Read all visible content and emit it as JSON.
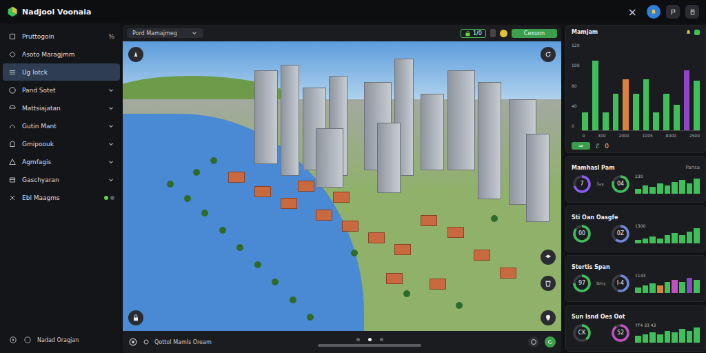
{
  "app": {
    "title": "Nadjool Voonaia"
  },
  "topbar": {
    "close": "×"
  },
  "sidebar": {
    "items": [
      {
        "label": "Pruttogoin",
        "badge": "⅜",
        "expandable": false,
        "selected": false
      },
      {
        "label": "Asoto Maragjmm",
        "expandable": false,
        "selected": false
      },
      {
        "label": "Ug lotck",
        "expandable": false,
        "selected": true
      },
      {
        "label": "Pand Sotet",
        "expandable": true,
        "selected": false
      },
      {
        "label": "Mattsiajatan",
        "expandable": true,
        "selected": false
      },
      {
        "label": "Gutin Mant",
        "expandable": true,
        "selected": false
      },
      {
        "label": "Gmipoouk",
        "expandable": true,
        "selected": false
      },
      {
        "label": "Agmfagis",
        "expandable": true,
        "selected": false
      },
      {
        "label": "Gaschyaran",
        "expandable": true,
        "selected": false
      },
      {
        "label": "Ebl Maagms",
        "expandable": false,
        "selected": false,
        "dots": [
          {
            "color": "#6ad04a"
          },
          {
            "color": "#5a5d63"
          }
        ]
      }
    ],
    "footer": "Nadad Oragjan"
  },
  "map": {
    "dropdown": "Pord Mamajmeg",
    "chip": "1/0",
    "button": "Cexuon",
    "footer": "Qottol Mamls Oream",
    "pages": [
      {
        "selected": false
      },
      {
        "selected": true
      },
      {
        "selected": false
      }
    ]
  },
  "chart": {
    "title": "Mamjam",
    "y_ticks": [
      "120",
      "100",
      "80",
      "40",
      "0"
    ],
    "x_ticks": [
      "0",
      "300",
      "2000",
      "1005",
      "8000",
      "2500"
    ],
    "max": 120,
    "values": [
      25,
      95,
      25,
      50,
      70,
      50,
      70,
      25,
      50,
      35,
      82,
      68
    ],
    "colors": [
      "#3fbf5a",
      "#3fbf5a",
      "#3fbf5a",
      "#3fbf5a",
      "#d9823b",
      "#3fbf5a",
      "#3fbf5a",
      "#3fbf5a",
      "#3fbf5a",
      "#3fbf5a",
      "#8e44c9",
      "#3fbf5a"
    ],
    "footer": {
      "button": "⇒",
      "link": "ℰ",
      "count": "0"
    }
  },
  "cards": [
    {
      "title": "Mamhasl Pam",
      "note": "Pansa",
      "mid": "3ay",
      "bars_label": "230",
      "gauges": [
        {
          "value": "7",
          "level": 0.7,
          "color": "#8b5cf6"
        },
        {
          "value": "04",
          "level": 0.8,
          "color": "#3fbf5a"
        }
      ],
      "bars": [
        3,
        5,
        4,
        6,
        5,
        7,
        8,
        6,
        9
      ],
      "bar_colors": [
        "#3fbf5a",
        "#3fbf5a",
        "#3fbf5a",
        "#3fbf5a",
        "#3fbf5a",
        "#3fbf5a",
        "#3fbf5a",
        "#3fbf5a",
        "#3fbf5a"
      ]
    },
    {
      "title": "Sti Oan Oasgfe",
      "mid": "",
      "bars_label": "1300",
      "gauges": [
        {
          "value": "00",
          "level": 0.85,
          "color": "#3fbf5a"
        },
        {
          "value": "0Z",
          "level": 0.6,
          "color": "#6f86d6"
        }
      ],
      "bars": [
        2,
        3,
        4,
        3,
        5,
        6,
        5,
        7,
        9
      ],
      "bar_colors": [
        "#3fbf5a",
        "#3fbf5a",
        "#3fbf5a",
        "#3fbf5a",
        "#3fbf5a",
        "#3fbf5a",
        "#3fbf5a",
        "#3fbf5a",
        "#3fbf5a"
      ]
    },
    {
      "title": "Stertis Span",
      "mid": "Bmy",
      "bars_label": "1143",
      "gauges": [
        {
          "value": "97",
          "level": 0.75,
          "color": "#3fbf5a"
        },
        {
          "value": "I-4",
          "level": 0.55,
          "color": "#6f86d6"
        }
      ],
      "bars": [
        3,
        4,
        5,
        4,
        6,
        7,
        6,
        8,
        7
      ],
      "bar_colors": [
        "#3fbf5a",
        "#3fbf5a",
        "#3fbf5a",
        "#d9823b",
        "#3fbf5a",
        "#c04fc0",
        "#3fbf5a",
        "#8e44c9",
        "#3fbf5a"
      ]
    },
    {
      "title": "Sun lsnd Oes Oot",
      "mid": "",
      "bars_label": "7T4 33 43",
      "gauges": [
        {
          "value": "CK",
          "level": 0.4,
          "color": "#3fbf5a"
        },
        {
          "value": "52",
          "level": 0.9,
          "color": "#c04fc0"
        }
      ],
      "bars": [
        4,
        5,
        6,
        5,
        7,
        6,
        8,
        7,
        9
      ],
      "bar_colors": [
        "#3fbf5a",
        "#3fbf5a",
        "#3fbf5a",
        "#3fbf5a",
        "#3fbf5a",
        "#3fbf5a",
        "#3fbf5a",
        "#3fbf5a",
        "#3fbf5a"
      ]
    }
  ]
}
